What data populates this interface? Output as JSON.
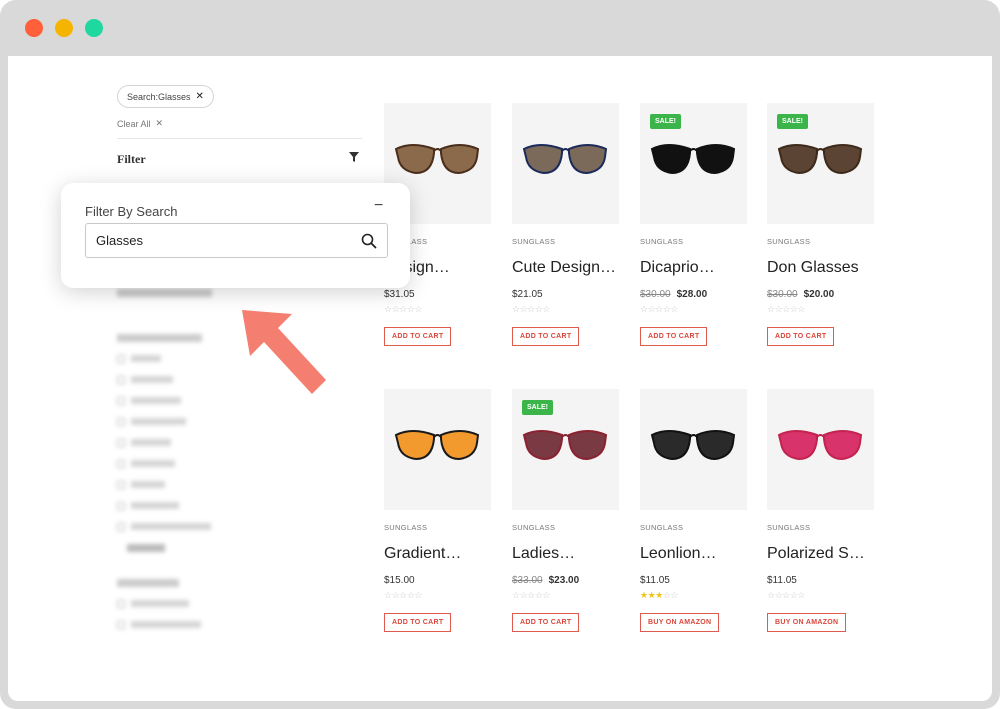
{
  "filters": {
    "active_chip": "Search:Glasses",
    "clear_all": "Clear All",
    "filter_title": "Filter"
  },
  "popover": {
    "label": "Filter By Search",
    "input_value": "Glasses"
  },
  "products": [
    {
      "category": "SUNGLASS",
      "name": "Designer Glasses",
      "display_name": "Design…",
      "price": "$31.05",
      "old_price": "",
      "sale": "",
      "rating": 0,
      "button": "ADD TO CART"
    },
    {
      "category": "SUNGLASS",
      "name": "Cute Designer",
      "display_name": "Cute Design…",
      "price": "$21.05",
      "old_price": "",
      "sale": "",
      "rating": 0,
      "button": "ADD TO CART"
    },
    {
      "category": "SUNGLASS",
      "name": "Dicaprio",
      "display_name": "Dicaprio…",
      "price": "$28.00",
      "old_price": "$30.00",
      "sale": "SALE!",
      "rating": 0,
      "button": "ADD TO CART"
    },
    {
      "category": "SUNGLASS",
      "name": "Don Glasses",
      "display_name": "Don Glasses",
      "price": "$20.00",
      "old_price": "$30.00",
      "sale": "SALE!",
      "rating": 0,
      "button": "ADD TO CART"
    },
    {
      "category": "SUNGLASS",
      "name": "Gradient",
      "display_name": "Gradient…",
      "price": "$15.00",
      "old_price": "",
      "sale": "",
      "rating": 0,
      "button": "ADD TO CART"
    },
    {
      "category": "SUNGLASS",
      "name": "Ladies",
      "display_name": "Ladies…",
      "price": "$23.00",
      "old_price": "$33.00",
      "sale": "SALE!",
      "rating": 0,
      "button": "ADD TO CART"
    },
    {
      "category": "SUNGLASS",
      "name": "Leonlion",
      "display_name": "Leonlion…",
      "price": "$11.05",
      "old_price": "",
      "sale": "",
      "rating": 3,
      "button": "BUY ON AMAZON"
    },
    {
      "category": "SUNGLASS",
      "name": "Polarized S",
      "display_name": "Polarized S…",
      "price": "$11.05",
      "old_price": "",
      "sale": "",
      "rating": 0,
      "button": "BUY ON AMAZON"
    }
  ]
}
